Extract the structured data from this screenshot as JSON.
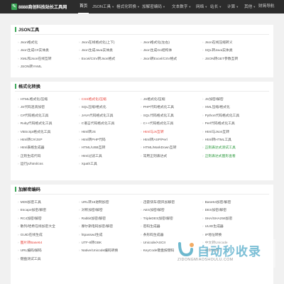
{
  "header": {
    "logo_icon": "wrench-icon",
    "site_title": "8888商创科技站长工具网",
    "nav": [
      {
        "label": "首页",
        "active": true
      },
      {
        "label": "JSON工具"
      },
      {
        "label": "格式化转换"
      },
      {
        "label": "加解密编码"
      },
      {
        "label": "文本数字"
      },
      {
        "label": "网络"
      },
      {
        "label": "站长"
      },
      {
        "label": "计算"
      },
      {
        "label": "其他"
      },
      {
        "label": "财简导航"
      }
    ]
  },
  "sections": [
    {
      "title": "JSON工具",
      "items": [
        {
          "label": "Json格式化"
        },
        {
          "label": "Json在线格式化(上下)"
        },
        {
          "label": "Json格式化(左右)"
        },
        {
          "label": "Json在线压缩转义"
        },
        {
          "label": "Json生成C#实体类"
        },
        {
          "label": "Json生成Java实体类"
        },
        {
          "label": "Json生成Go结构体"
        },
        {
          "label": "SQL转Java实体类"
        },
        {
          "label": "XML和Json在线互转"
        },
        {
          "label": "Excel/CSV转Json格式"
        },
        {
          "label": "Json转Excel/CSV格式"
        },
        {
          "label": "JSON转GET参数互转"
        },
        {
          "label": "JSON转YAML"
        }
      ]
    },
    {
      "title": "格式化转换",
      "items": [
        {
          "label": "HTML格式化/压缩"
        },
        {
          "label": "CSS格式化/压缩",
          "style": "red"
        },
        {
          "label": "JS格式化/压缩"
        },
        {
          "label": "JS加密/解密"
        },
        {
          "label": "JS代码混淆加密"
        },
        {
          "label": "SQL压缩/格式化"
        },
        {
          "label": "PHP代码格式化工具"
        },
        {
          "label": "XML压缩/格式化"
        },
        {
          "label": "C#代码格式化工具"
        },
        {
          "label": "JAVA代码格式化工具"
        },
        {
          "label": "SQL代码格式化工具"
        },
        {
          "label": "Python代码格式化工具"
        },
        {
          "label": "Ruby代码格式化工具"
        },
        {
          "label": "C语言代码格式化工具"
        },
        {
          "label": "C++代码格式化工具"
        },
        {
          "label": "Perl代码格式化工具"
        },
        {
          "label": "VBScript格式化工具"
        },
        {
          "label": "Html转JS"
        },
        {
          "label": "Html与Js互转",
          "style": "red"
        },
        {
          "label": "Html与Json互转"
        },
        {
          "label": "Html转C#/JSP"
        },
        {
          "label": "Html转PHP代码"
        },
        {
          "label": "Html转ASP/Perl"
        },
        {
          "label": "Html转HTML工具"
        },
        {
          "label": "Html表格生成器"
        },
        {
          "label": "HTML/UBB互转"
        },
        {
          "label": "HTML/MarkDown互转"
        },
        {
          "label": "正则表达式测试工具",
          "style": "green"
        },
        {
          "label": "正则生成代码"
        },
        {
          "label": "Html过滤工具"
        },
        {
          "label": "常用正则表达式"
        },
        {
          "label": "正则表达式图形查看",
          "style": "green"
        },
        {
          "label": "运行js/html/css"
        },
        {
          "label": "Xpath工具"
        }
      ]
    },
    {
      "title": "加解密编码",
      "items": [
        {
          "label": "MD5加密工具"
        },
        {
          "label": "URL转16进制加密"
        },
        {
          "label": "迅雷快车/旋风加解密"
        },
        {
          "label": "Base64加密/解密"
        },
        {
          "label": "Escape加密/解密"
        },
        {
          "label": "对称加密/解密"
        },
        {
          "label": "AES加密/解密"
        },
        {
          "label": "DES加密/解密"
        },
        {
          "label": "RC4加密/解密"
        },
        {
          "label": "Rabbit加密/解密"
        },
        {
          "label": "TripleDES加密/解密"
        },
        {
          "label": "SHA/SHA256加密"
        },
        {
          "label": "散列/哈希在线加密大全"
        },
        {
          "label": "摩尔斯电码加密/解密"
        },
        {
          "label": "密码生成器"
        },
        {
          "label": "UUID生成器"
        },
        {
          "label": "GUID在线生成"
        },
        {
          "label": "htpasswd生成"
        },
        {
          "label": "条形码生成器"
        },
        {
          "label": "IP地址转换"
        },
        {
          "label": "图片转Base64",
          "style": "red"
        },
        {
          "label": "UTF-8转GBK"
        },
        {
          "label": "Unicode/ASCII"
        },
        {
          "label": "中文转Unicode"
        },
        {
          "label": "URL编码/解码"
        },
        {
          "label": "Native/Unicode编码转换"
        },
        {
          "label": "KeyCode键盘按键码"
        },
        {
          "label": "进制转换"
        },
        {
          "label": "键盘测试工具"
        }
      ]
    }
  ],
  "watermark": {
    "text": "自动秒收录",
    "sub": "ZIDONGMIAOSHOULU.COM"
  }
}
